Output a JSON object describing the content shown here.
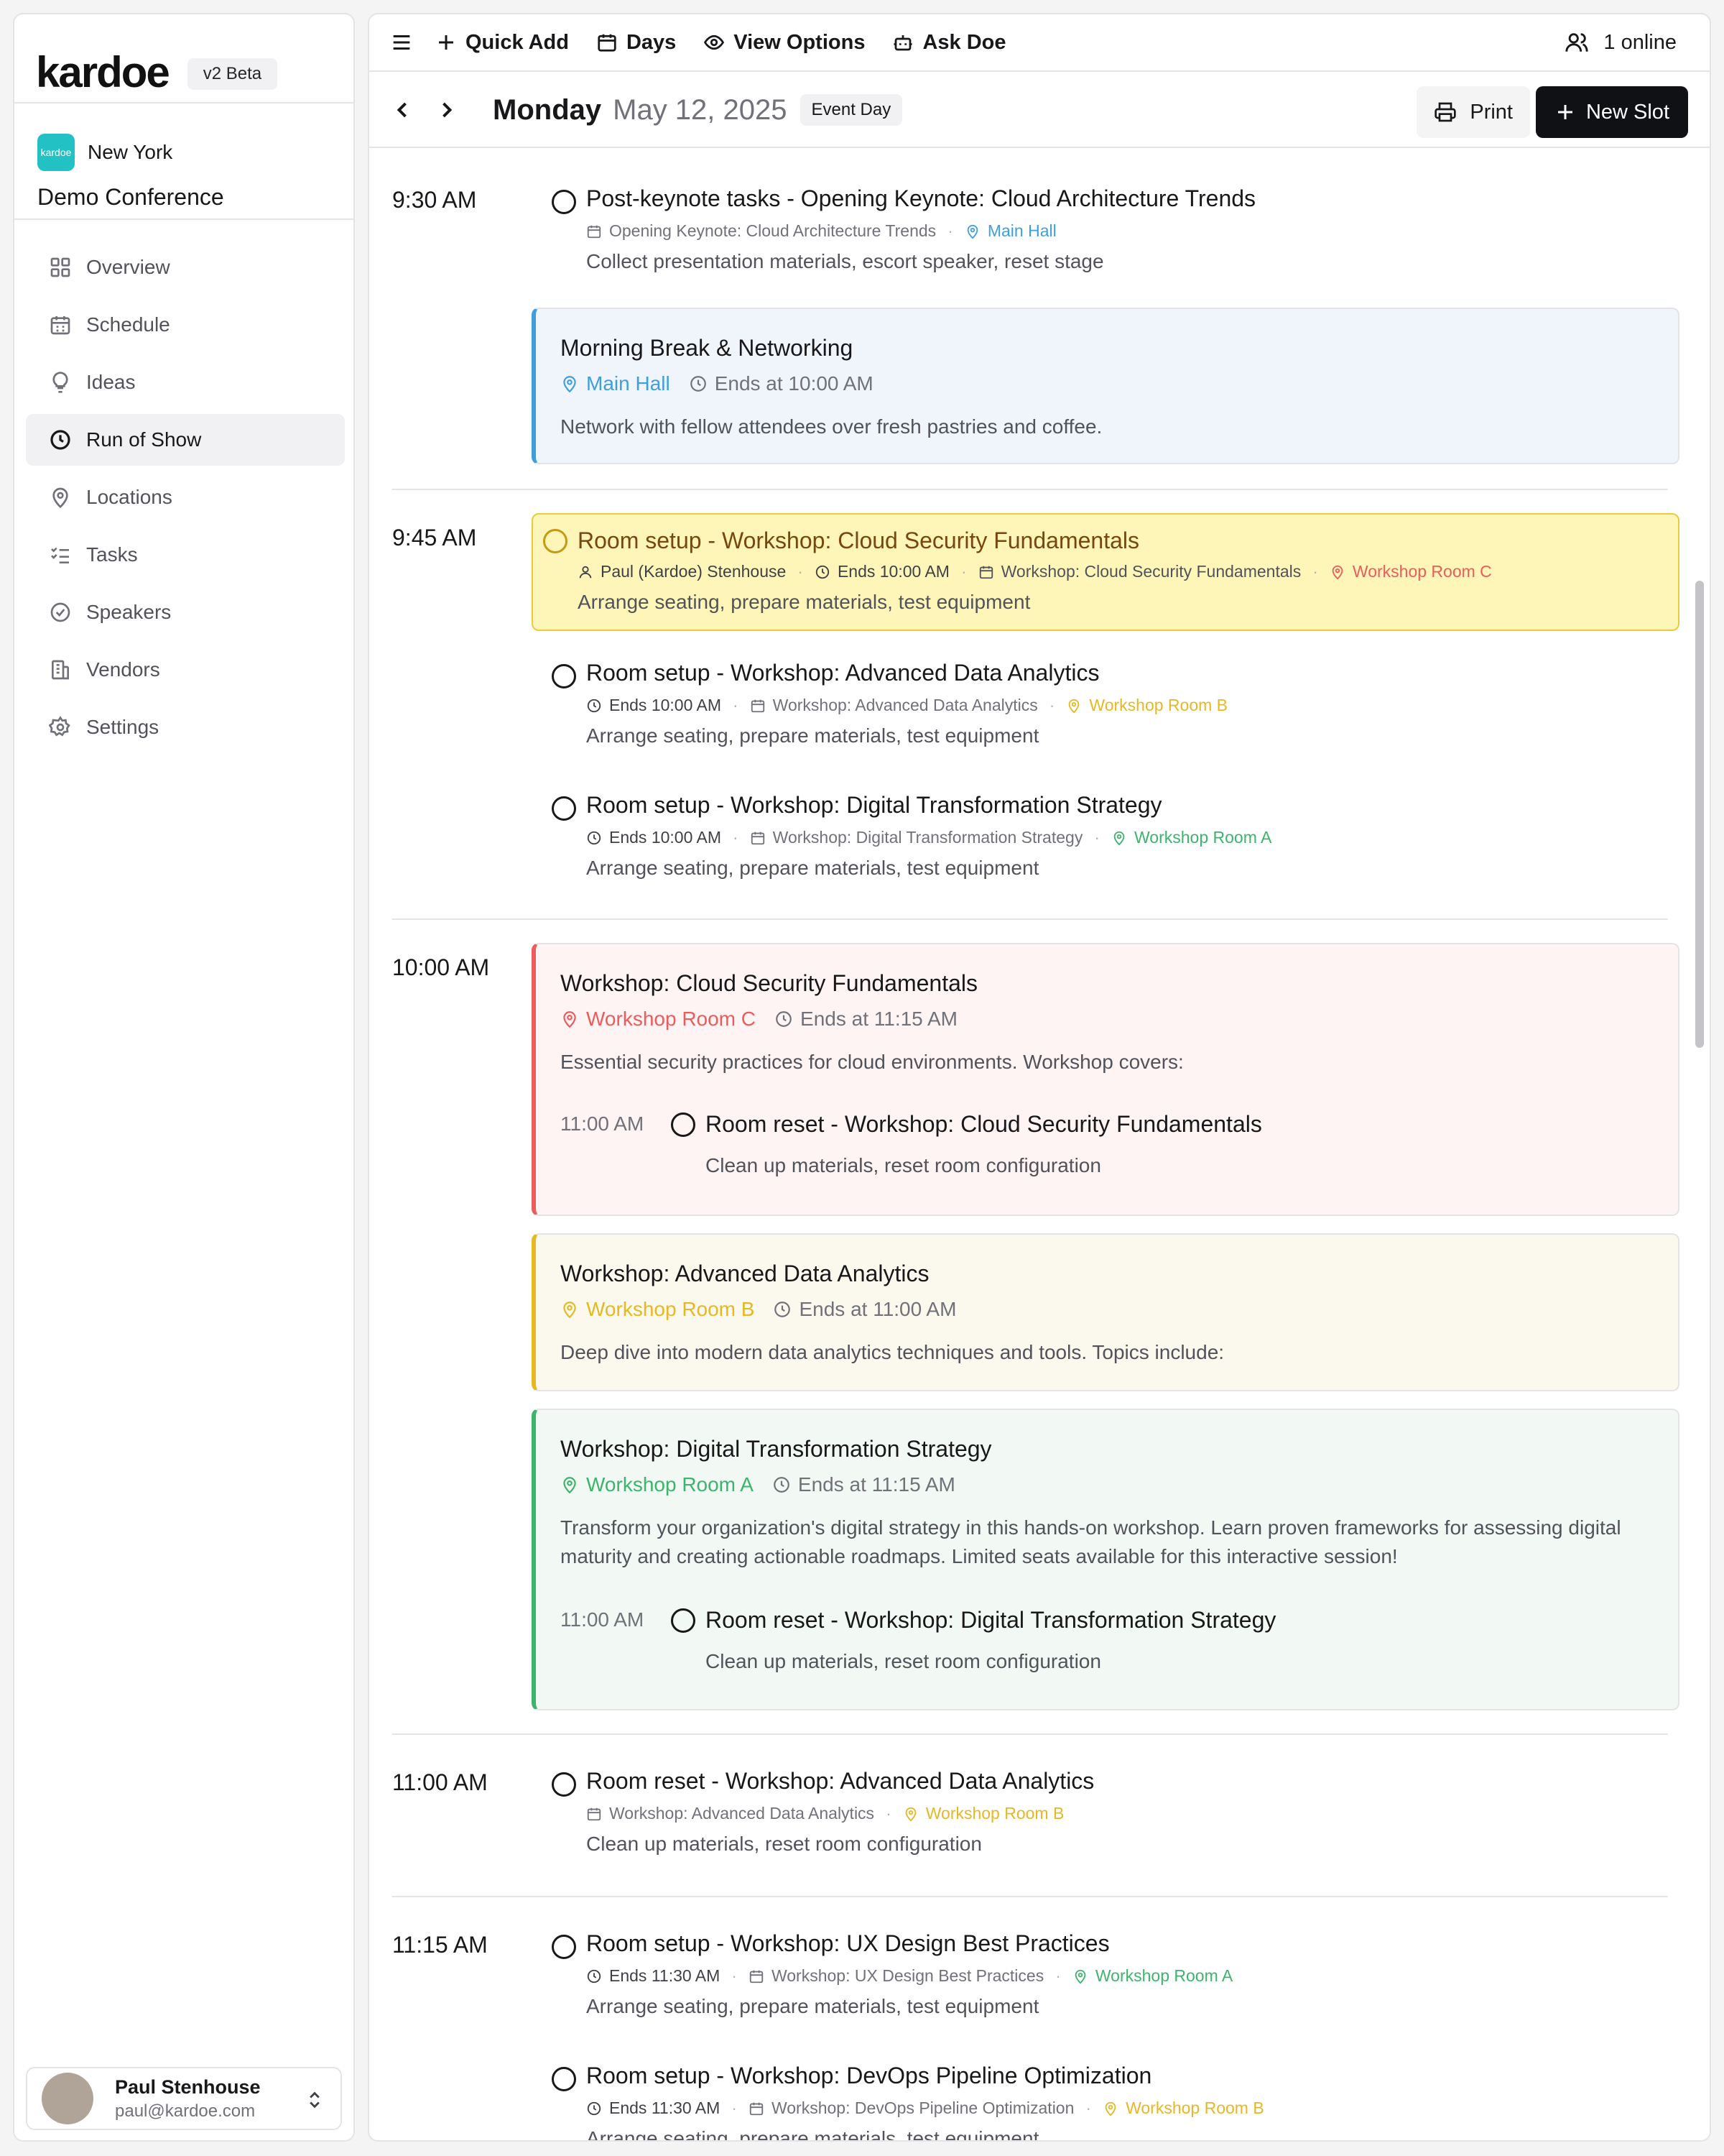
{
  "sidebar": {
    "logo": "kardoe",
    "badge": "v2 Beta",
    "org_logo_text": "kardoe",
    "org_city": "New York",
    "event_name": "Demo Conference",
    "nav": [
      {
        "label": "Overview",
        "icon": "grid-icon"
      },
      {
        "label": "Schedule",
        "icon": "calendar-icon"
      },
      {
        "label": "Ideas",
        "icon": "lightbulb-icon"
      },
      {
        "label": "Run of Show",
        "icon": "clock-icon",
        "active": true
      },
      {
        "label": "Locations",
        "icon": "map-pin-icon"
      },
      {
        "label": "Tasks",
        "icon": "list-checks-icon"
      },
      {
        "label": "Speakers",
        "icon": "badge-check-icon"
      },
      {
        "label": "Vendors",
        "icon": "building-icon"
      },
      {
        "label": "Settings",
        "icon": "gear-icon"
      }
    ],
    "user": {
      "name": "Paul Stenhouse",
      "email": "paul@kardoe.com"
    }
  },
  "toolbar": {
    "quick_add": "Quick Add",
    "days": "Days",
    "view_options": "View Options",
    "ask_doe": "Ask Doe",
    "online": "1 online"
  },
  "date_header": {
    "weekday": "Monday",
    "date": "May 12, 2025",
    "badge": "Event Day",
    "print": "Print",
    "new_slot": "New Slot"
  },
  "colors": {
    "main_hall": "#3f9fdc",
    "room_a": "#3db46d",
    "room_b": "#e6b824",
    "room_c": "#ec5c5c",
    "primary_button": "#0f1115"
  },
  "times": {
    "t0930": "9:30 AM",
    "t0945": "9:45 AM",
    "t1000": "10:00 AM",
    "t1100": "11:00 AM",
    "t1115": "11:15 AM"
  },
  "tasks": {
    "keynote_post": {
      "title": "Post-keynote tasks - Opening Keynote: Cloud Architecture Trends",
      "session": "Opening Keynote: Cloud Architecture Trends",
      "location": "Main Hall",
      "desc": "Collect presentation materials, escort speaker, reset stage"
    },
    "setup_security": {
      "title": "Room setup - Workshop: Cloud Security Fundamentals",
      "assignee": "Paul (Kardoe) Stenhouse",
      "ends": "Ends 10:00 AM",
      "session": "Workshop: Cloud Security Fundamentals",
      "location": "Workshop Room C",
      "desc": "Arrange seating, prepare materials, test equipment"
    },
    "setup_analytics": {
      "title": "Room setup - Workshop: Advanced Data Analytics",
      "ends": "Ends 10:00 AM",
      "session": "Workshop: Advanced Data Analytics",
      "location": "Workshop Room B",
      "desc": "Arrange seating, prepare materials, test equipment"
    },
    "setup_digital": {
      "title": "Room setup - Workshop: Digital Transformation Strategy",
      "ends": "Ends 10:00 AM",
      "session": "Workshop: Digital Transformation Strategy",
      "location": "Workshop Room A",
      "desc": "Arrange seating, prepare materials, test equipment"
    },
    "reset_analytics": {
      "title": "Room reset - Workshop: Advanced Data Analytics",
      "session": "Workshop: Advanced Data Analytics",
      "location": "Workshop Room B",
      "desc": "Clean up materials, reset room configuration"
    },
    "setup_ux": {
      "title": "Room setup - Workshop: UX Design Best Practices",
      "ends": "Ends 11:30 AM",
      "session": "Workshop: UX Design Best Practices",
      "location": "Workshop Room A",
      "desc": "Arrange seating, prepare materials, test equipment"
    },
    "setup_devops": {
      "title": "Room setup - Workshop: DevOps Pipeline Optimization",
      "ends": "Ends 11:30 AM",
      "session": "Workshop: DevOps Pipeline Optimization",
      "location": "Workshop Room B",
      "desc": "Arrange seating, prepare materials, test equipment"
    }
  },
  "slots": {
    "break": {
      "title": "Morning Break & Networking",
      "location": "Main Hall",
      "ends": "Ends at 10:00 AM",
      "desc": "Network with fellow attendees over fresh pastries and coffee."
    },
    "security": {
      "title": "Workshop: Cloud Security Fundamentals",
      "location": "Workshop Room C",
      "ends": "Ends at 11:15 AM",
      "desc": "Essential security practices for cloud environments. Workshop covers:",
      "sub": {
        "time": "11:00 AM",
        "title": "Room reset - Workshop: Cloud Security Fundamentals",
        "desc": "Clean up materials, reset room configuration"
      }
    },
    "analytics": {
      "title": "Workshop: Advanced Data Analytics",
      "location": "Workshop Room B",
      "ends": "Ends at 11:00 AM",
      "desc": "Deep dive into modern data analytics techniques and tools. Topics include:"
    },
    "digital": {
      "title": "Workshop: Digital Transformation Strategy",
      "location": "Workshop Room A",
      "ends": "Ends at 11:15 AM",
      "desc": "Transform your organization's digital strategy in this hands-on workshop. Learn proven frameworks for assessing digital maturity and creating actionable roadmaps. Limited seats available for this interactive session!",
      "sub": {
        "time": "11:00 AM",
        "title": "Room reset - Workshop: Digital Transformation Strategy",
        "desc": "Clean up materials, reset room configuration"
      }
    }
  }
}
